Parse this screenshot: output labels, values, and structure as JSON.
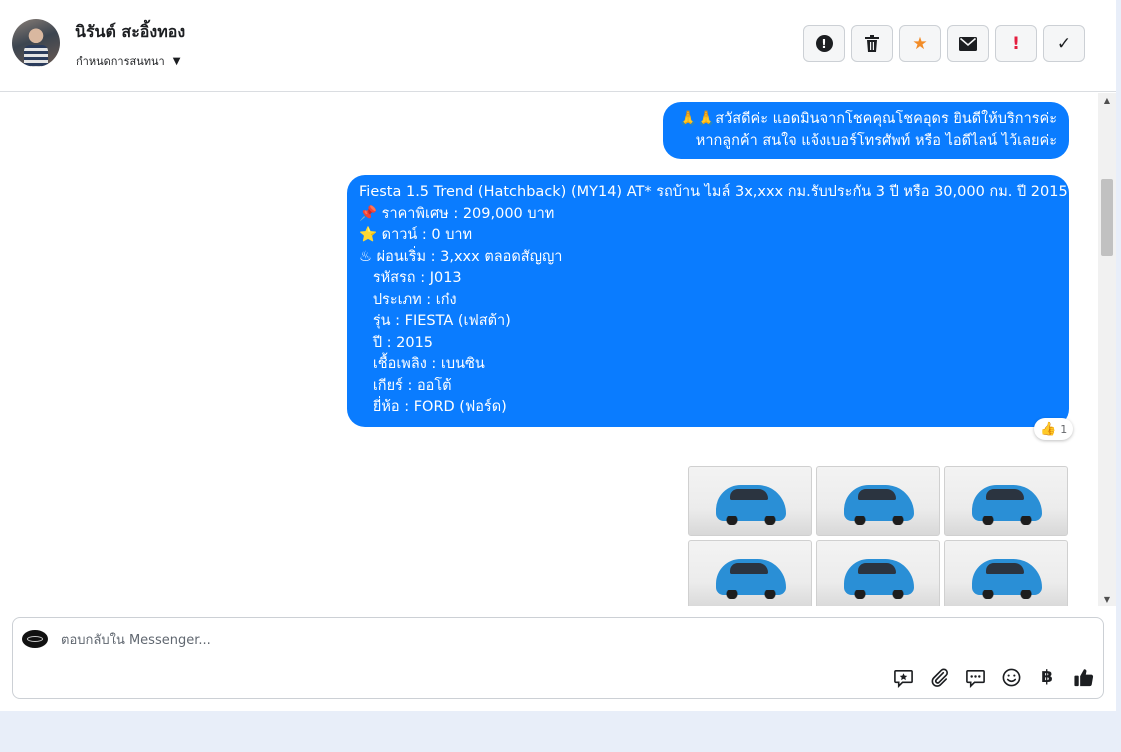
{
  "header": {
    "contact_name": "นิรันต์ สะอิ้งทอง",
    "assign_label": "กำหนดการสนทนา",
    "assign_caret": "▼",
    "toolbar": [
      {
        "name": "spam-button",
        "glyph": "!"
      },
      {
        "name": "delete-button",
        "glyph": "🗑"
      },
      {
        "name": "star-button",
        "glyph": "★"
      },
      {
        "name": "mark-unread-button",
        "glyph": "✉"
      },
      {
        "name": "important-button",
        "glyph": "!"
      },
      {
        "name": "mark-done-button",
        "glyph": "✓"
      }
    ]
  },
  "messages": {
    "greeting_lines": [
      "🙏🙏สวัสดีค่ะ แอดมินจากโชคคุณโชคอุดร ยินดีให้บริการค่ะ",
      "หากลูกค้า สนใจ แจ้งเบอร์โทรศัพท์ หรือ ไอดีไลน์  ไว้เลยค่ะ"
    ],
    "listing_lines": [
      "Fiesta 1.5 Trend (Hatchback) (MY14) AT* รถบ้าน ไมล์ 3x,xxx กม.รับประกัน 3 ปี หรือ 30,000 กม. ปี 2015",
      "📌 ราคาพิเศษ : 209,000 บาท",
      "⭐ ดาวน์ : 0 บาท",
      "♨ ผ่อนเริ่ม : 3,xxx ตลอดสัญญา",
      "   รหัสรถ : J013",
      "   ประเภท : เก๋ง",
      "   รุ่น : FIESTA (เฟสต้า)",
      "   ปี : 2015",
      "   เชื้อเพลิง : เบนซิน",
      "   เกียร์ : ออโต้",
      "   ยี่ห้อ : FORD (ฟอร์ด)"
    ],
    "reaction": {
      "emoji": "👍",
      "count": "1"
    },
    "photo_count": 6
  },
  "scrollbar": {
    "up": "▲",
    "down": "▼"
  },
  "composer": {
    "placeholder": "ตอบกลับใน Messenger...",
    "baht_symbol": "฿"
  }
}
